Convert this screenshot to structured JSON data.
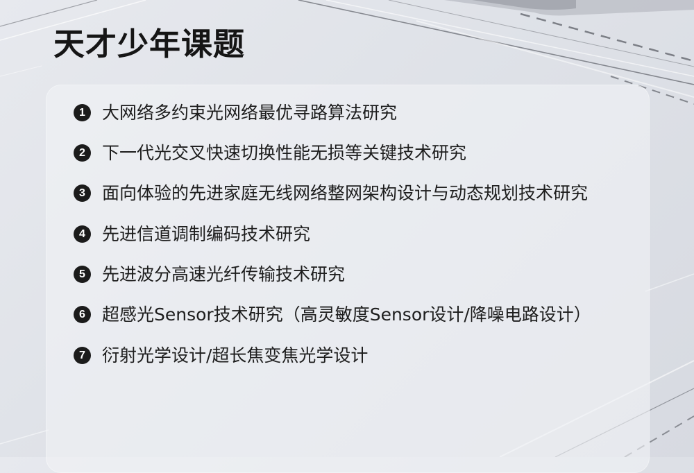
{
  "page": {
    "title": "天才少年课题"
  },
  "topics": [
    {
      "number": "1",
      "text": "大网络多约束光网络最优寻路算法研究"
    },
    {
      "number": "2",
      "text": "下一代光交叉快速切换性能无损等关键技术研究"
    },
    {
      "number": "3",
      "text": "面向体验的先进家庭无线网络整网架构设计与动态规划技术研究"
    },
    {
      "number": "4",
      "text": "先进信道调制编码技术研究"
    },
    {
      "number": "5",
      "text": "先进波分高速光纤传输技术研究"
    },
    {
      "number": "6",
      "text": "超感光Sensor技术研究（高灵敏度Sensor设计/降噪电路设计）"
    },
    {
      "number": "7",
      "text": "衍射光学设计/超长焦变焦光学设计"
    }
  ],
  "colors": {
    "background": "#e2e5ea",
    "card": "#eff1f4",
    "text": "#1d1d1d",
    "badge": "#1b1b1b"
  }
}
